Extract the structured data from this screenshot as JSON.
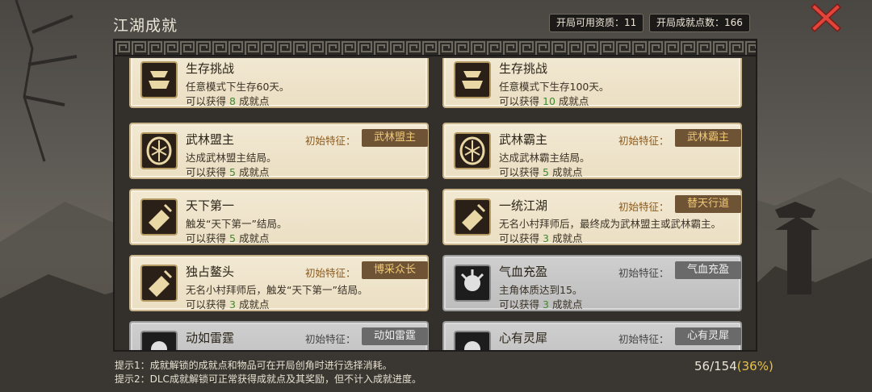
{
  "header": {
    "title": "江湖成就",
    "available_label": "开局可用资质：",
    "available_value": "11",
    "points_label": "开局成就点数：",
    "points_value": "166"
  },
  "cards": [
    {
      "name": "生存挑战",
      "desc": "任意模式下生存60天。",
      "reward_prefix": "可以获得",
      "points": "8",
      "reward_suffix": "成就点",
      "trait_label": "",
      "trait": "",
      "state": "unlocked",
      "icon": "banner-cup-icon"
    },
    {
      "name": "生存挑战",
      "desc": "任意模式下生存100天。",
      "reward_prefix": "可以获得",
      "points": "10",
      "reward_suffix": "成就点",
      "trait_label": "",
      "trait": "",
      "state": "unlocked",
      "icon": "banner-cup-icon"
    },
    {
      "name": "武林盟主",
      "desc": "达成武林盟主结局。",
      "reward_prefix": "可以获得",
      "points": "5",
      "reward_suffix": "成就点",
      "trait_label": "初始特征：",
      "trait": "武林盟主",
      "state": "unlocked",
      "icon": "crest-icon"
    },
    {
      "name": "武林霸主",
      "desc": "达成武林霸主结局。",
      "reward_prefix": "可以获得",
      "points": "5",
      "reward_suffix": "成就点",
      "trait_label": "初始特征：",
      "trait": "武林霸主",
      "state": "unlocked",
      "icon": "crest-icon"
    },
    {
      "name": "天下第一",
      "desc": "触发“天下第一”结局。",
      "reward_prefix": "可以获得",
      "points": "5",
      "reward_suffix": "成就点",
      "trait_label": "",
      "trait": "",
      "state": "unlocked",
      "icon": "scroll-sword-icon"
    },
    {
      "name": "一统江湖",
      "desc": "无名小村拜师后，最终成为武林盟主或武林霸主。",
      "reward_prefix": "可以获得",
      "points": "3",
      "reward_suffix": "成就点",
      "trait_label": "初始特征：",
      "trait": "替天行道",
      "state": "unlocked",
      "icon": "scroll-sword-icon"
    },
    {
      "name": "独占鳌头",
      "desc": "无名小村拜师后，触发“天下第一”结局。",
      "reward_prefix": "可以获得",
      "points": "3",
      "reward_suffix": "成就点",
      "trait_label": "初始特征：",
      "trait": "博采众长",
      "state": "unlocked",
      "icon": "scroll-sword-icon"
    },
    {
      "name": "气血充盈",
      "desc": "主角体质达到15。",
      "reward_prefix": "可以获得",
      "points": "3",
      "reward_suffix": "成就点",
      "trait_label": "初始特征：",
      "trait": "气血充盈",
      "state": "locked",
      "icon": "fist-icon"
    },
    {
      "name": "动如雷霆",
      "desc": "",
      "reward_prefix": "",
      "points": "",
      "reward_suffix": "",
      "trait_label": "初始特征：",
      "trait": "动如雷霆",
      "state": "locked",
      "icon": "fist-icon"
    },
    {
      "name": "心有灵犀",
      "desc": "",
      "reward_prefix": "",
      "points": "",
      "reward_suffix": "",
      "trait_label": "初始特征：",
      "trait": "心有灵犀",
      "state": "locked",
      "icon": "fist-icon"
    }
  ],
  "hints": [
    "提示1：成就解锁的成就点和物品可在开局创角时进行选择消耗。",
    "提示2：DLC成就解锁可正常获得成就点及其奖励，但不计入成就进度。"
  ],
  "progress": {
    "count": "56/154",
    "percent": "(36%)"
  },
  "colors": {
    "reward_points": "#3f8a2e",
    "trait_tag_text": "#f0c977",
    "close_icon": "#e0443a",
    "progress_percent": "#e8c24a"
  }
}
